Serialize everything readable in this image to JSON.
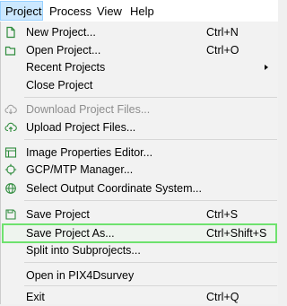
{
  "menubar": {
    "items": [
      {
        "label": "Project"
      },
      {
        "label": "Process"
      },
      {
        "label": "View"
      },
      {
        "label": "Help"
      }
    ]
  },
  "menu": {
    "items": [
      {
        "label": "New Project...",
        "shortcut": "Ctrl+N",
        "icon": "new-file-icon"
      },
      {
        "label": "Open Project...",
        "shortcut": "Ctrl+O",
        "icon": "folder-open-icon"
      },
      {
        "label": "Recent Projects",
        "shortcut": "",
        "icon": "",
        "submenu": true
      },
      {
        "label": "Close Project",
        "shortcut": "",
        "icon": ""
      },
      {
        "label": "Download Project Files...",
        "shortcut": "",
        "icon": "cloud-download-icon",
        "disabled": true
      },
      {
        "label": "Upload Project Files...",
        "shortcut": "",
        "icon": "cloud-upload-icon"
      },
      {
        "label": "Image Properties Editor...",
        "shortcut": "",
        "icon": "image-properties-icon"
      },
      {
        "label": "GCP/MTP Manager...",
        "shortcut": "",
        "icon": "crosshair-icon"
      },
      {
        "label": "Select Output Coordinate System...",
        "shortcut": "",
        "icon": "globe-icon"
      },
      {
        "label": "Save Project",
        "shortcut": "Ctrl+S",
        "icon": "save-icon",
        "highlighted": true
      },
      {
        "label": "Save Project As...",
        "shortcut": "Ctrl+Shift+S",
        "icon": ""
      },
      {
        "label": "Split into Subprojects...",
        "shortcut": "",
        "icon": ""
      },
      {
        "label": "Open in PIX4Dsurvey",
        "shortcut": "",
        "icon": ""
      },
      {
        "label": "Exit",
        "shortcut": "Ctrl+Q",
        "icon": ""
      }
    ]
  },
  "colors": {
    "highlight_border": "#6ee26e",
    "menubar_active": "#cce8ff",
    "icon_green": "#2e8b3c"
  }
}
